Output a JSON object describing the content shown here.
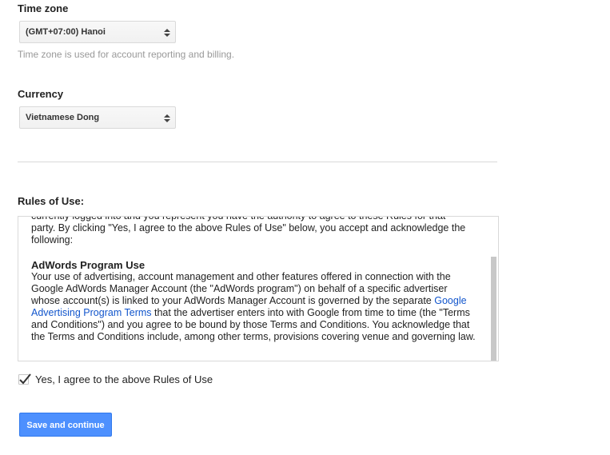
{
  "timezone": {
    "label": "Time zone",
    "value": "(GMT+07:00) Hanoi",
    "hint": "Time zone is used for account reporting and billing."
  },
  "currency": {
    "label": "Currency",
    "value": "Vietnamese Dong"
  },
  "rules": {
    "label": "Rules of Use:",
    "partial_line": "currently logged into and you represent you have the authority to agree to these Rules for that",
    "intro": "party. By clicking \"Yes, I agree to the above Rules of Use\" below, you accept and acknowledge the following:",
    "section_heading": "AdWords Program Use",
    "section_text_1": "Your use of advertising, account management and other features offered in connection with the Google AdWords Manager Account (the \"AdWords program\") on behalf of a specific advertiser whose account(s) is linked to your AdWords Manager Account is governed by the separate",
    "section_link": "Google Advertising Program Terms",
    "section_text_2": "that the advertiser enters into with Google from time to time (the \"Terms and Conditions\") and you agree to be bound by those Terms and Conditions. You acknowledge that the Terms and Conditions include, among other terms, provisions covering venue and governing law."
  },
  "agree": {
    "label": "Yes, I agree to the above Rules of Use",
    "checked": true
  },
  "save_button": "Save and continue",
  "colors": {
    "primary": "#4d90fe",
    "link": "#1155cc"
  }
}
